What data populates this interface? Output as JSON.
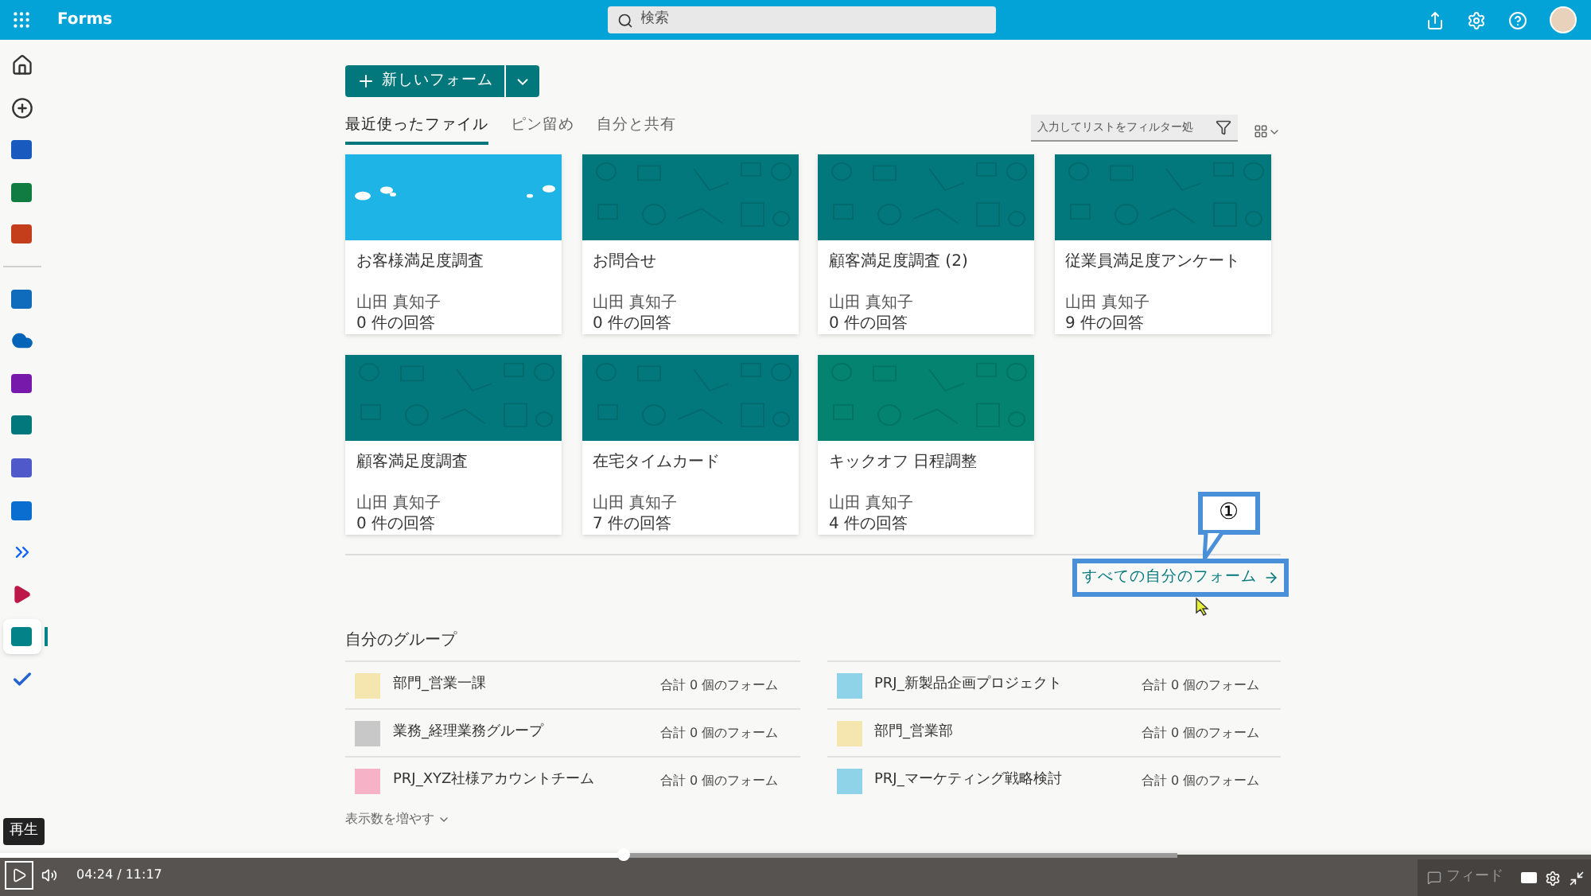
{
  "header": {
    "app_name": "Forms",
    "search": {
      "placeholder": "検索"
    }
  },
  "rail": [
    {
      "kind": "home",
      "selected": false
    },
    {
      "kind": "add",
      "selected": false
    },
    {
      "kind": "app",
      "color": "#185abd",
      "selected": false
    },
    {
      "kind": "app",
      "color": "#107c41",
      "selected": false
    },
    {
      "kind": "app",
      "color": "#c43e1c",
      "selected": false
    },
    {
      "kind": "divider"
    },
    {
      "kind": "app",
      "color": "#0f6cbd",
      "selected": false
    },
    {
      "kind": "cloud",
      "color": "#0364b8",
      "selected": false
    },
    {
      "kind": "app",
      "color": "#7719aa",
      "selected": false
    },
    {
      "kind": "app",
      "color": "#03787c",
      "selected": false
    },
    {
      "kind": "app",
      "color": "#5059c9",
      "selected": false
    },
    {
      "kind": "app",
      "color": "#0a6ed1",
      "selected": false
    },
    {
      "kind": "chevron",
      "color": "#0f62fe",
      "selected": false
    },
    {
      "kind": "play",
      "color": "#bc1948",
      "selected": false
    },
    {
      "kind": "app",
      "color": "#038387",
      "selected": true
    },
    {
      "kind": "check",
      "color": "#2564cf",
      "selected": false
    }
  ],
  "new_form_button": "新しいフォーム",
  "tabs": [
    {
      "label": "最近使ったファイル",
      "selected": true
    },
    {
      "label": "ピン留め",
      "selected": false
    },
    {
      "label": "自分と共有",
      "selected": false
    }
  ],
  "filter": {
    "placeholder": "入力してリストをフィルター処"
  },
  "cards": [
    {
      "title": "お客様満足度調査",
      "owner": "山田 真知子",
      "responses": "0 件の回答",
      "kind": "sky",
      "color": "#1fb4e6"
    },
    {
      "title": "お問合せ",
      "owner": "山田 真知子",
      "responses": "0 件の回答",
      "kind": "pattern",
      "color": "#03787c"
    },
    {
      "title": "顧客満足度調査 (2)",
      "owner": "山田 真知子",
      "responses": "0 件の回答",
      "kind": "pattern",
      "color": "#03787c"
    },
    {
      "title": "従業員満足度アンケート",
      "owner": "山田 真知子",
      "responses": "9 件の回答",
      "kind": "pattern",
      "color": "#03787c"
    },
    {
      "title": "顧客満足度調査",
      "owner": "山田 真知子",
      "responses": "0 件の回答",
      "kind": "pattern",
      "color": "#03787c"
    },
    {
      "title": "在宅タイムカード",
      "owner": "山田 真知子",
      "responses": "7 件の回答",
      "kind": "pattern",
      "color": "#03787c"
    },
    {
      "title": "キックオフ 日程調整",
      "owner": "山田 真知子",
      "responses": "4 件の回答",
      "kind": "pattern",
      "color": "#038370"
    }
  ],
  "callout": "①",
  "all_forms_link": "すべての自分のフォーム",
  "groups": {
    "title": "自分のグループ",
    "items": [
      {
        "name": "部門_営業一課",
        "count": "合計 0 個のフォーム",
        "color": "#f5e6b0"
      },
      {
        "name": "PRJ_新製品企画プロジェクト",
        "count": "合計 0 個のフォーム",
        "color": "#8fd3e8"
      },
      {
        "name": "業務_経理業務グループ",
        "count": "合計 0 個のフォーム",
        "color": "#c8c8c8"
      },
      {
        "name": "部門_営業部",
        "count": "合計 0 個のフォーム",
        "color": "#f5e6b0"
      },
      {
        "name": "PRJ_XYZ社様アカウントチーム",
        "count": "合計 0 個のフォーム",
        "color": "#f6b3c8"
      },
      {
        "name": "PRJ_マーケティング戦略検討",
        "count": "合計 0 個のフォーム",
        "color": "#8fd3e8"
      }
    ],
    "show_more": "表示数を増やす"
  },
  "player": {
    "tooltip": "再生",
    "time": "04:24 / 11:17",
    "level": 0.53,
    "feedback": "フィード"
  }
}
